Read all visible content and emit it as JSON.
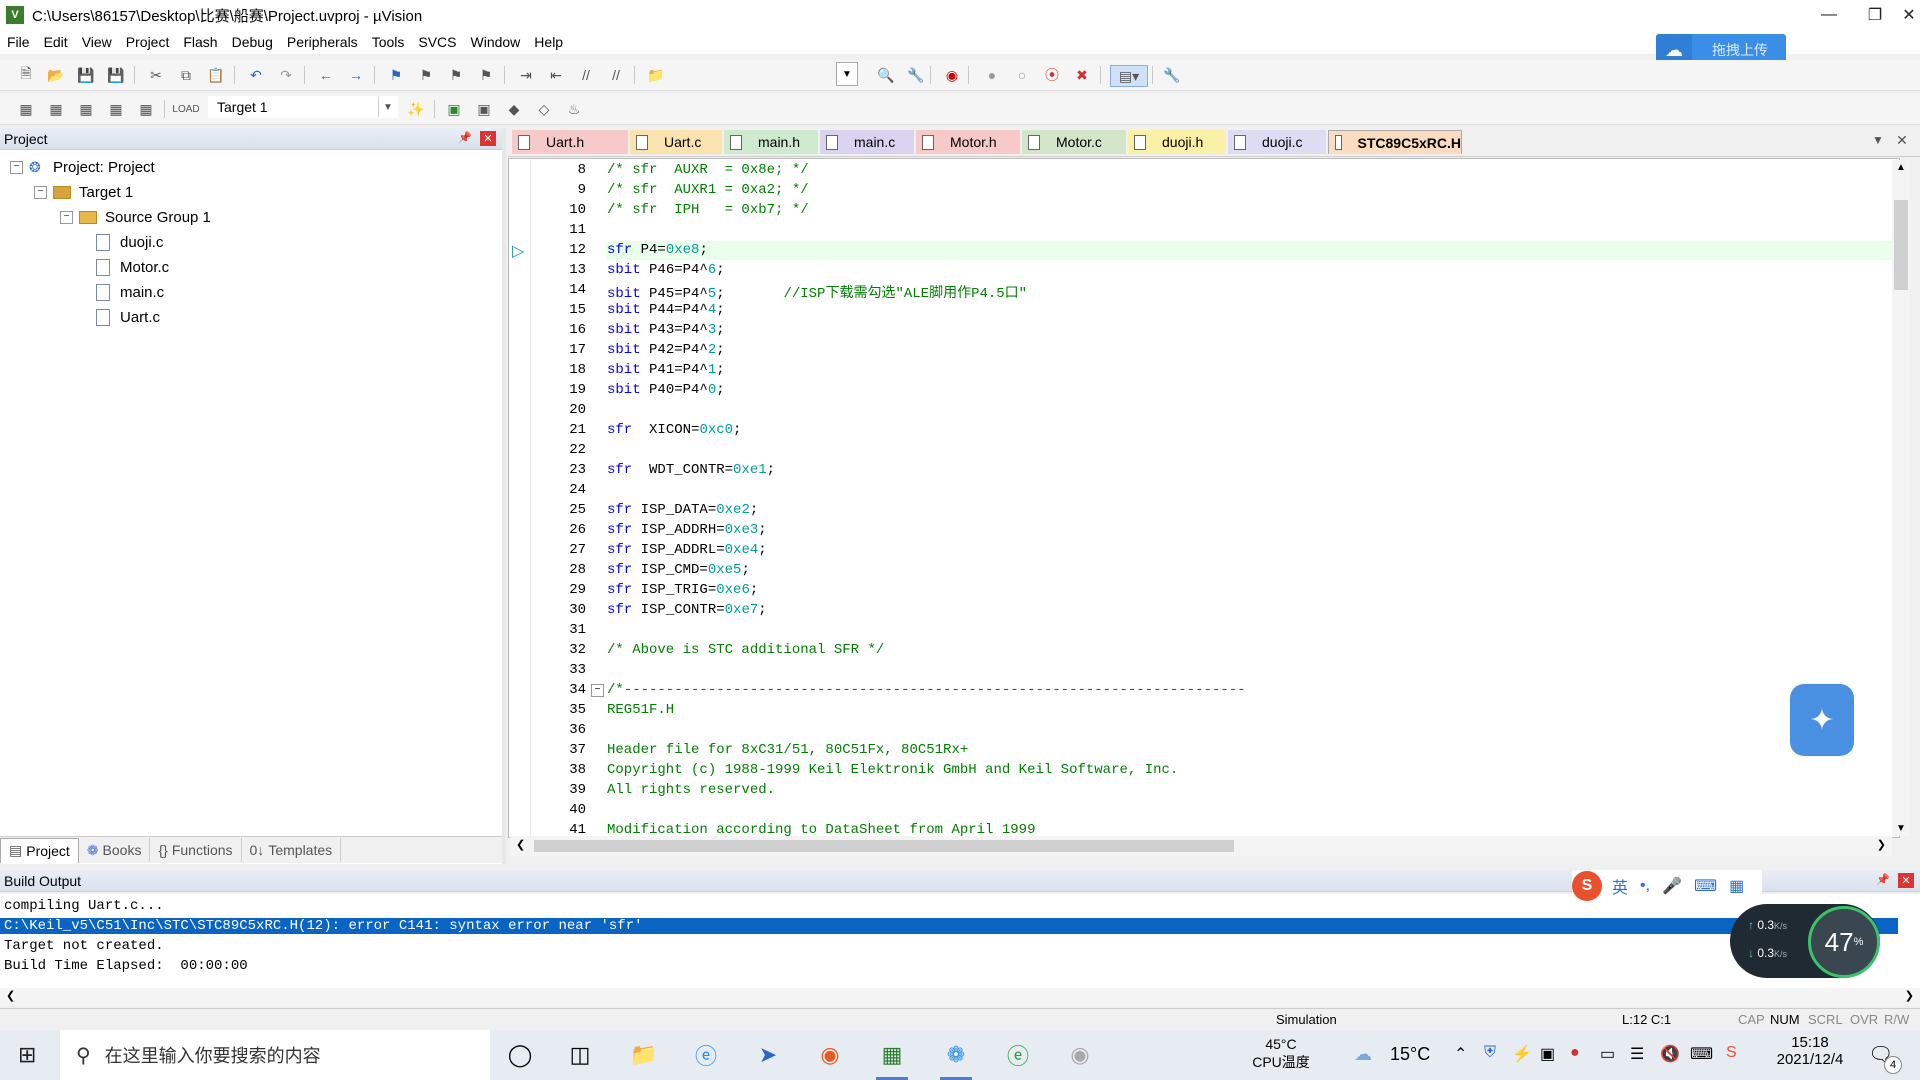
{
  "window": {
    "title": "C:\\Users\\86157\\Desktop\\比赛\\船赛\\Project.uvproj - µVision",
    "app_icon": "V"
  },
  "menu": [
    "File",
    "Edit",
    "View",
    "Project",
    "Flash",
    "Debug",
    "Peripherals",
    "Tools",
    "SVCS",
    "Window",
    "Help"
  ],
  "upload_button": "拖拽上传",
  "target": {
    "selected": "Target 1"
  },
  "project_panel": {
    "title": "Project",
    "root": "Project: Project",
    "target": "Target 1",
    "group": "Source Group 1",
    "files": [
      "duoji.c",
      "Motor.c",
      "main.c",
      "Uart.c"
    ],
    "tabs": [
      "Project",
      "Books",
      "Functions",
      "Templates"
    ]
  },
  "editor_tabs": [
    {
      "label": "Uart.h",
      "color": "#f7c9c9"
    },
    {
      "label": "Uart.c",
      "color": "#fbe3b0"
    },
    {
      "label": "main.h",
      "color": "#cfe9cf"
    },
    {
      "label": "main.c",
      "color": "#d9d3f0"
    },
    {
      "label": "Motor.h",
      "color": "#f7c9c9"
    },
    {
      "label": "Motor.c",
      "color": "#d4e6c9"
    },
    {
      "label": "duoji.h",
      "color": "#fbf0a8"
    },
    {
      "label": "duoji.c",
      "color": "#dcdcf2"
    },
    {
      "label": "STC89C5xRC.H",
      "color": "#fbdcc0"
    }
  ],
  "code_lines": [
    {
      "n": "8",
      "t": "/* sfr  AUXR  = 0x8e; */"
    },
    {
      "n": "9",
      "t": "/* sfr  AUXR1 = 0xa2; */"
    },
    {
      "n": "10",
      "t": "/* sfr  IPH   = 0xb7; */"
    },
    {
      "n": "11",
      "t": ""
    },
    {
      "n": "12",
      "t": "sfr P4=0xe8;"
    },
    {
      "n": "13",
      "t": "sbit P46=P4^6;"
    },
    {
      "n": "14",
      "t": "sbit P45=P4^5;       //ISP下载需勾选\"ALE脚用作P4.5口\""
    },
    {
      "n": "15",
      "t": "sbit P44=P4^4;"
    },
    {
      "n": "16",
      "t": "sbit P43=P4^3;"
    },
    {
      "n": "17",
      "t": "sbit P42=P4^2;"
    },
    {
      "n": "18",
      "t": "sbit P41=P4^1;"
    },
    {
      "n": "19",
      "t": "sbit P40=P4^0;"
    },
    {
      "n": "20",
      "t": ""
    },
    {
      "n": "21",
      "t": "sfr  XICON=0xc0;"
    },
    {
      "n": "22",
      "t": ""
    },
    {
      "n": "23",
      "t": "sfr  WDT_CONTR=0xe1;"
    },
    {
      "n": "24",
      "t": ""
    },
    {
      "n": "25",
      "t": "sfr ISP_DATA=0xe2;"
    },
    {
      "n": "26",
      "t": "sfr ISP_ADDRH=0xe3;"
    },
    {
      "n": "27",
      "t": "sfr ISP_ADDRL=0xe4;"
    },
    {
      "n": "28",
      "t": "sfr ISP_CMD=0xe5;"
    },
    {
      "n": "29",
      "t": "sfr ISP_TRIG=0xe6;"
    },
    {
      "n": "30",
      "t": "sfr ISP_CONTR=0xe7;"
    },
    {
      "n": "31",
      "t": ""
    },
    {
      "n": "32",
      "t": "/* Above is STC additional SFR */"
    },
    {
      "n": "33",
      "t": ""
    },
    {
      "n": "34",
      "t": "/*--------------------------------------------------------------------------"
    },
    {
      "n": "35",
      "t": "REG51F.H"
    },
    {
      "n": "36",
      "t": ""
    },
    {
      "n": "37",
      "t": "Header file for 8xC31/51, 80C51Fx, 80C51Rx+"
    },
    {
      "n": "38",
      "t": "Copyright (c) 1988-1999 Keil Elektronik GmbH and Keil Software, Inc."
    },
    {
      "n": "39",
      "t": "All rights reserved."
    },
    {
      "n": "40",
      "t": ""
    },
    {
      "n": "41",
      "t": "Modification according to DataSheet from April 1999"
    }
  ],
  "build_output": {
    "title": "Build Output",
    "lines": [
      "compiling Uart.c...",
      "C:\\Keil_v5\\C51\\Inc\\STC\\STC89C5xRC.H(12): error C141: syntax error near 'sfr'",
      "Target not created.",
      "Build Time Elapsed:  00:00:00"
    ],
    "selected_index": 1
  },
  "status": {
    "mode": "Simulation",
    "pos": "L:12 C:1",
    "caps": "CAP",
    "num": "NUM",
    "scrl": "SCRL",
    "ovr": "OVR",
    "rw": "R/W"
  },
  "taskbar": {
    "search_placeholder": "在这里输入你要搜索的内容",
    "cpu_temp": "45°C",
    "cpu_label": "CPU温度",
    "weather": "15°C",
    "time": "15:18",
    "date": "2021/12/4",
    "notifications": "4"
  },
  "ime": {
    "lang": "英"
  },
  "network": {
    "up": "0.3",
    "down": "0.3",
    "unit": "K/s",
    "percent": "47",
    "pct_sign": "%"
  }
}
